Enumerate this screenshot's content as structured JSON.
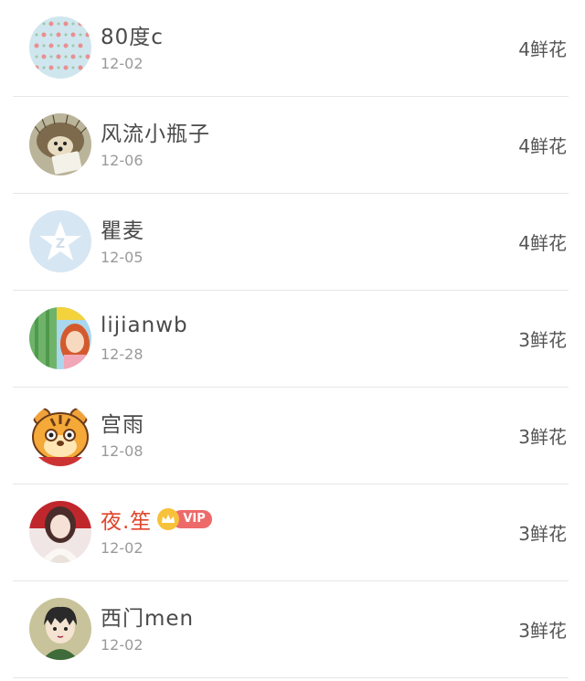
{
  "rows": [
    {
      "name": "80度c",
      "date": "12-02",
      "flowers": "4鲜花",
      "vip": false,
      "avatar": "pattern-avatar"
    },
    {
      "name": "风流小瓶子",
      "date": "12-06",
      "flowers": "4鲜花",
      "vip": false,
      "avatar": "hedgehog-avatar"
    },
    {
      "name": "瞿麦",
      "date": "12-05",
      "flowers": "4鲜花",
      "vip": false,
      "avatar": "qzone-star-avatar"
    },
    {
      "name": "lijianwb",
      "date": "12-28",
      "flowers": "3鲜花",
      "vip": false,
      "avatar": "cartoon-girl-avatar"
    },
    {
      "name": "宫雨",
      "date": "12-08",
      "flowers": "3鲜花",
      "vip": false,
      "avatar": "tiger-avatar"
    },
    {
      "name": "夜.笙",
      "date": "12-02",
      "flowers": "3鲜花",
      "vip": true,
      "vip_label": "VIP",
      "avatar": "girl-photo-avatar"
    },
    {
      "name": "西门men",
      "date": "12-02",
      "flowers": "3鲜花",
      "vip": false,
      "avatar": "anime-boy-avatar"
    }
  ],
  "colors": {
    "vip_name": "#e0442a",
    "vip_tag": "#ee6a6a",
    "vip_crown": "#f7c23b",
    "divider": "#e6e6e6"
  }
}
